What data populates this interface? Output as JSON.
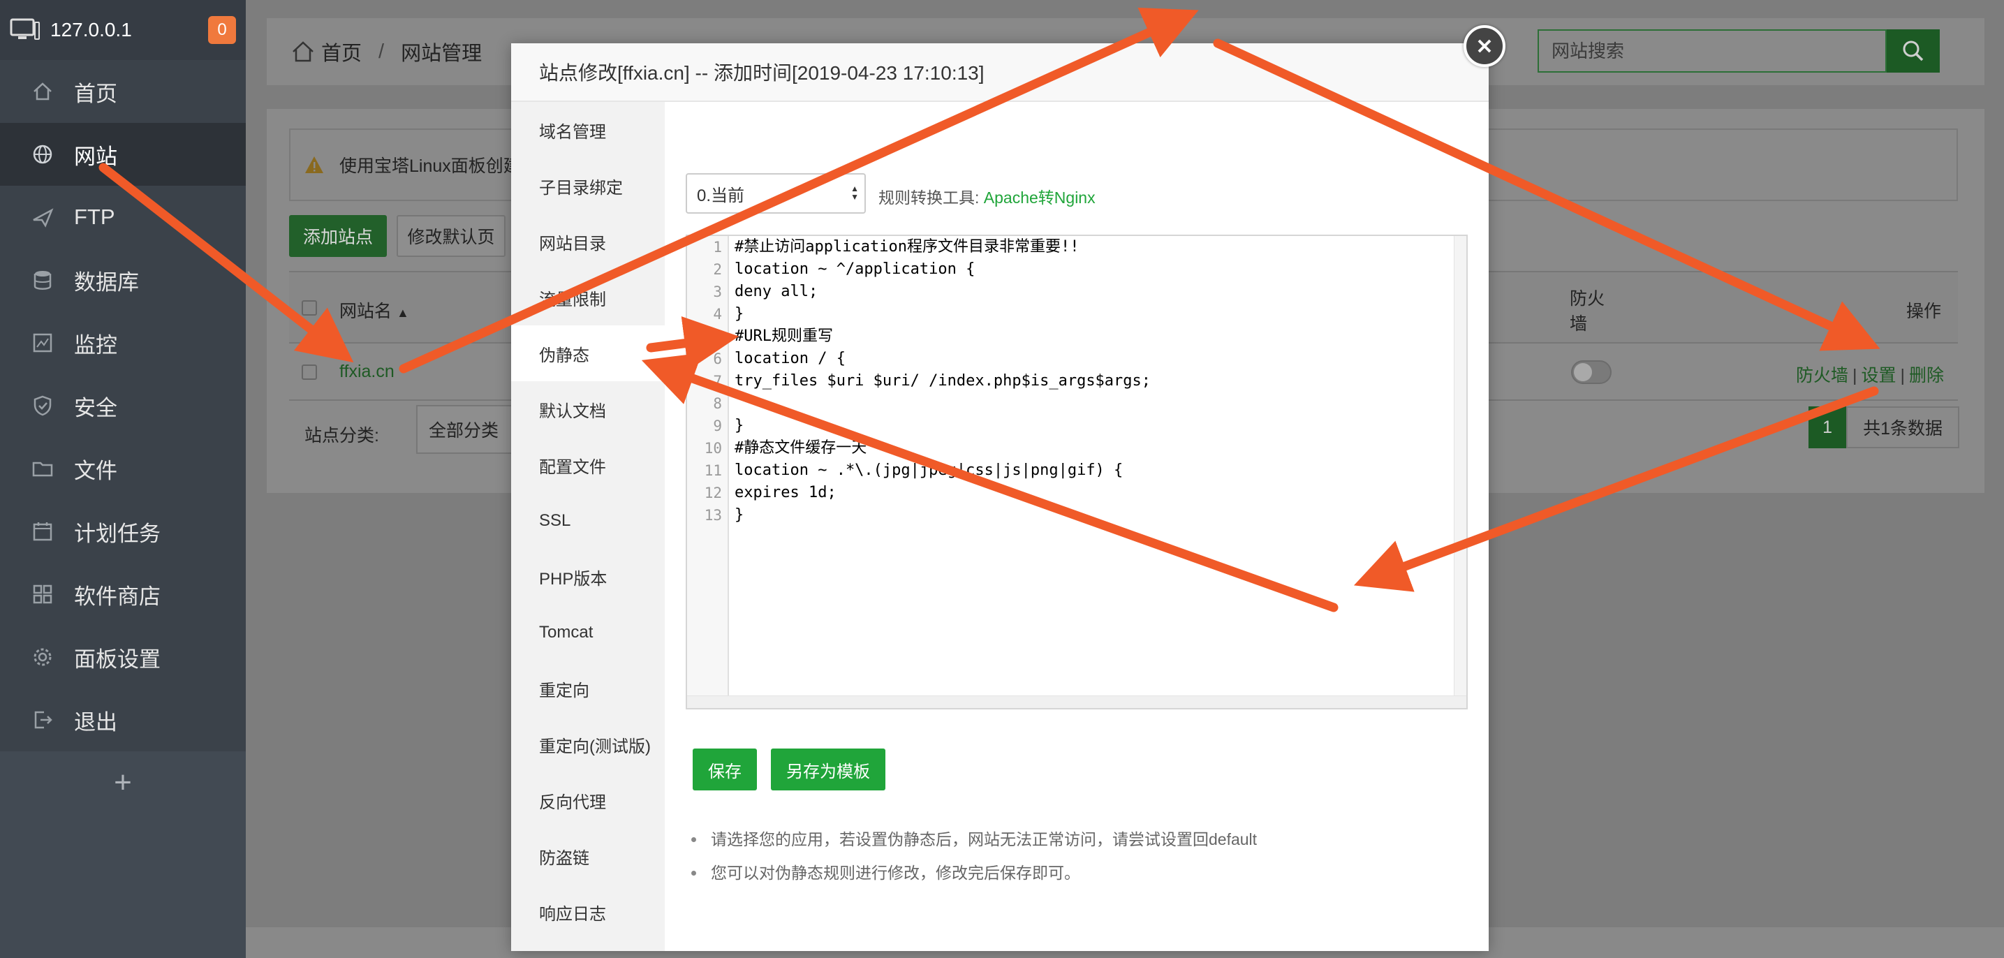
{
  "sidebar": {
    "host": "127.0.0.1",
    "badge": "0",
    "items": [
      {
        "label": "首页",
        "icon": "home-icon"
      },
      {
        "label": "网站",
        "icon": "globe-icon"
      },
      {
        "label": "FTP",
        "icon": "ftp-icon"
      },
      {
        "label": "数据库",
        "icon": "database-icon"
      },
      {
        "label": "监控",
        "icon": "monitor-chart-icon"
      },
      {
        "label": "安全",
        "icon": "shield-icon"
      },
      {
        "label": "文件",
        "icon": "folder-icon"
      },
      {
        "label": "计划任务",
        "icon": "calendar-icon"
      },
      {
        "label": "软件商店",
        "icon": "grid-icon"
      },
      {
        "label": "面板设置",
        "icon": "gear-icon"
      },
      {
        "label": "退出",
        "icon": "logout-icon"
      }
    ],
    "add_label": "+"
  },
  "breadcrumb": {
    "home": "首页",
    "sep": "/",
    "current": "网站管理"
  },
  "search": {
    "placeholder": "网站搜索"
  },
  "panel": {
    "notice": "使用宝塔Linux面板创建",
    "add_site": "添加站点",
    "modify_default": "修改默认页",
    "table": {
      "col_name": "网站名",
      "col_firewall": "防火\n墙",
      "col_ops": "操作",
      "row": {
        "site": "ffxia.cn",
        "op_firewall": "防火墙",
        "op_settings": "设置",
        "op_delete": "删除",
        "sep": "|"
      }
    },
    "category_label": "站点分类:",
    "category_value": "全部分类",
    "pager_current": "1",
    "pager_total": "共1条数据"
  },
  "modal": {
    "title": "站点修改[ffxia.cn] -- 添加时间[2019-04-23 17:10:13]",
    "tabs": [
      "域名管理",
      "子目录绑定",
      "网站目录",
      "流量限制",
      "伪静态",
      "默认文档",
      "配置文件",
      "SSL",
      "PHP版本",
      "Tomcat",
      "重定向",
      "重定向(测试版)",
      "反向代理",
      "防盗链",
      "响应日志"
    ],
    "active_tab": "伪静态",
    "version_select": "0.当前",
    "converter_label": "规则转换工具:",
    "converter_link": "Apache转Nginx",
    "code_lines": [
      "#禁止访问application程序文件目录非常重要!!",
      "location ~ ^/application {",
      "deny all;",
      "}",
      "#URL规则重写",
      "location / {",
      "try_files $uri $uri/ /index.php$is_args$args;",
      "",
      "}",
      "#静态文件缓存一天",
      "location ~ .*\\.(jpg|jpeg|css|js|png|gif) {",
      "expires 1d;",
      "}"
    ],
    "save_label": "保存",
    "save_template_label": "另存为模板",
    "tips": [
      "请选择您的应用，若设置伪静态后，网站无法正常访问，请尝试设置回default",
      "您可以对伪静态规则进行修改，修改完后保存即可。"
    ]
  },
  "colors": {
    "accent": "#20a53a",
    "arrow": "#f05a28",
    "sidebar": "#424a53"
  }
}
